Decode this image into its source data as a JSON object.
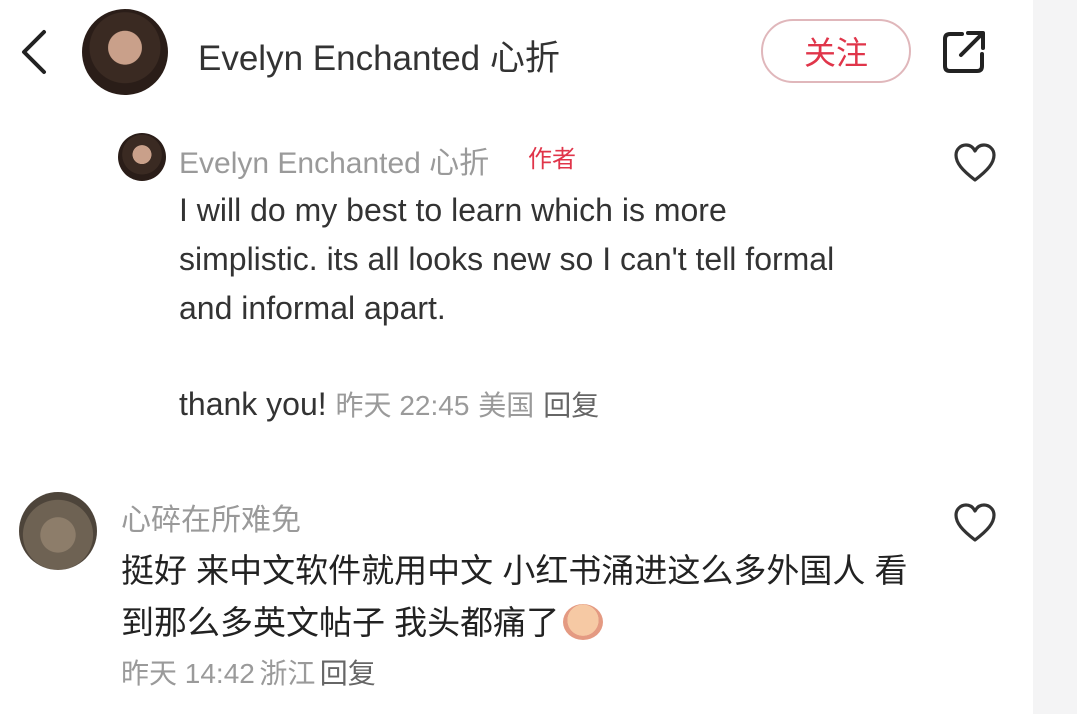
{
  "header": {
    "back_icon": "chevron-left-icon",
    "username": "Evelyn Enchanted 心折",
    "follow_label": "关注",
    "share_icon": "share-icon",
    "accent_color": "#e0354a"
  },
  "comments": [
    {
      "username": "Evelyn Enchanted 心折",
      "badge": "作者",
      "lines": [
        "I will do my best to learn which is more",
        "simplistic. its all looks new so I can't tell formal",
        "and informal apart."
      ],
      "tail_text": "thank you!",
      "time": "昨天 22:45",
      "location": "美国",
      "reply_label": "回复",
      "like_icon": "heart-icon"
    },
    {
      "username": "心碎在所难免",
      "text": "挺好 来中文软件就用中文 小红书涌进这么多外国人 看到那么多英文帖子 我头都痛了",
      "emoji": "crying-face-emoji",
      "time": "昨天 14:42",
      "location": "浙江",
      "reply_label": "回复",
      "like_icon": "heart-icon"
    }
  ]
}
